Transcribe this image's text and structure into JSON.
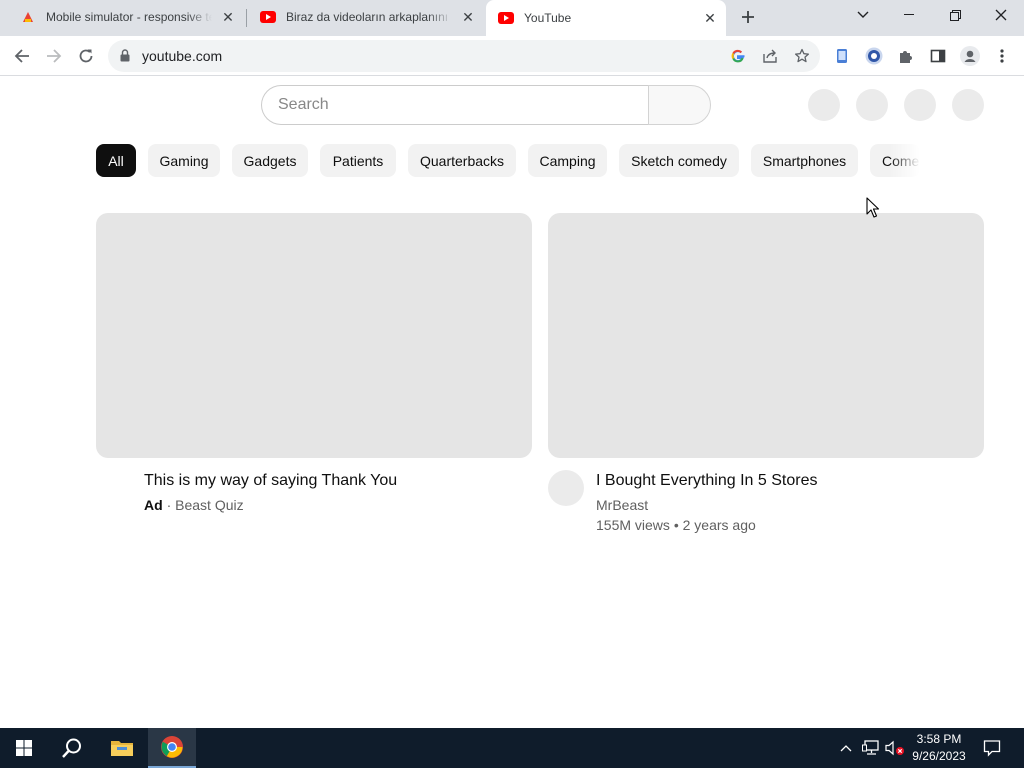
{
  "browser": {
    "tabs": [
      {
        "title": "Mobile simulator - responsive testing"
      },
      {
        "title": "Biraz da videoların arkaplanını gör"
      },
      {
        "title": "YouTube"
      }
    ],
    "new_tab_label": "+",
    "url": "youtube.com"
  },
  "youtube": {
    "search_placeholder": "Search",
    "chips": [
      "All",
      "Gaming",
      "Gadgets",
      "Patients",
      "Quarterbacks",
      "Camping",
      "Sketch comedy",
      "Smartphones",
      "Comedy"
    ],
    "selected_chip": "All",
    "videos": [
      {
        "title": "This is my way of saying Thank You",
        "badge": "Ad",
        "separator": "·",
        "channel": "Beast Quiz"
      },
      {
        "title": "I Bought Everything In 5 Stores",
        "channel": "MrBeast",
        "views": "155M views",
        "separator": "•",
        "age": "2 years ago"
      }
    ]
  },
  "taskbar": {
    "time": "3:58 PM",
    "date": "9/26/2023"
  },
  "colors": {
    "tabstrip_bg": "#dee1e6",
    "youtube_red": "#ff0000",
    "chip_selected": "#0f0f0f",
    "placeholder_grey": "#e5e5e5",
    "taskbar_bg": "#0f1c2b"
  },
  "icons": [
    "chrome-tab-favicon",
    "youtube-favicon",
    "close-icon",
    "plus-icon",
    "chevron-down-icon",
    "minimize-icon",
    "restore-icon",
    "back-arrow-icon",
    "forward-arrow-icon",
    "reload-icon",
    "lock-icon",
    "google-icon",
    "share-icon",
    "star-icon",
    "extension-icons",
    "puzzle-icon",
    "side-panel-icon",
    "profile-icon",
    "more-vert-icon",
    "windows-start-icon",
    "search-icon",
    "folder-icon",
    "chrome-icon",
    "chevron-up-icon",
    "network-icon",
    "speaker-muted-icon",
    "notification-icon"
  ]
}
